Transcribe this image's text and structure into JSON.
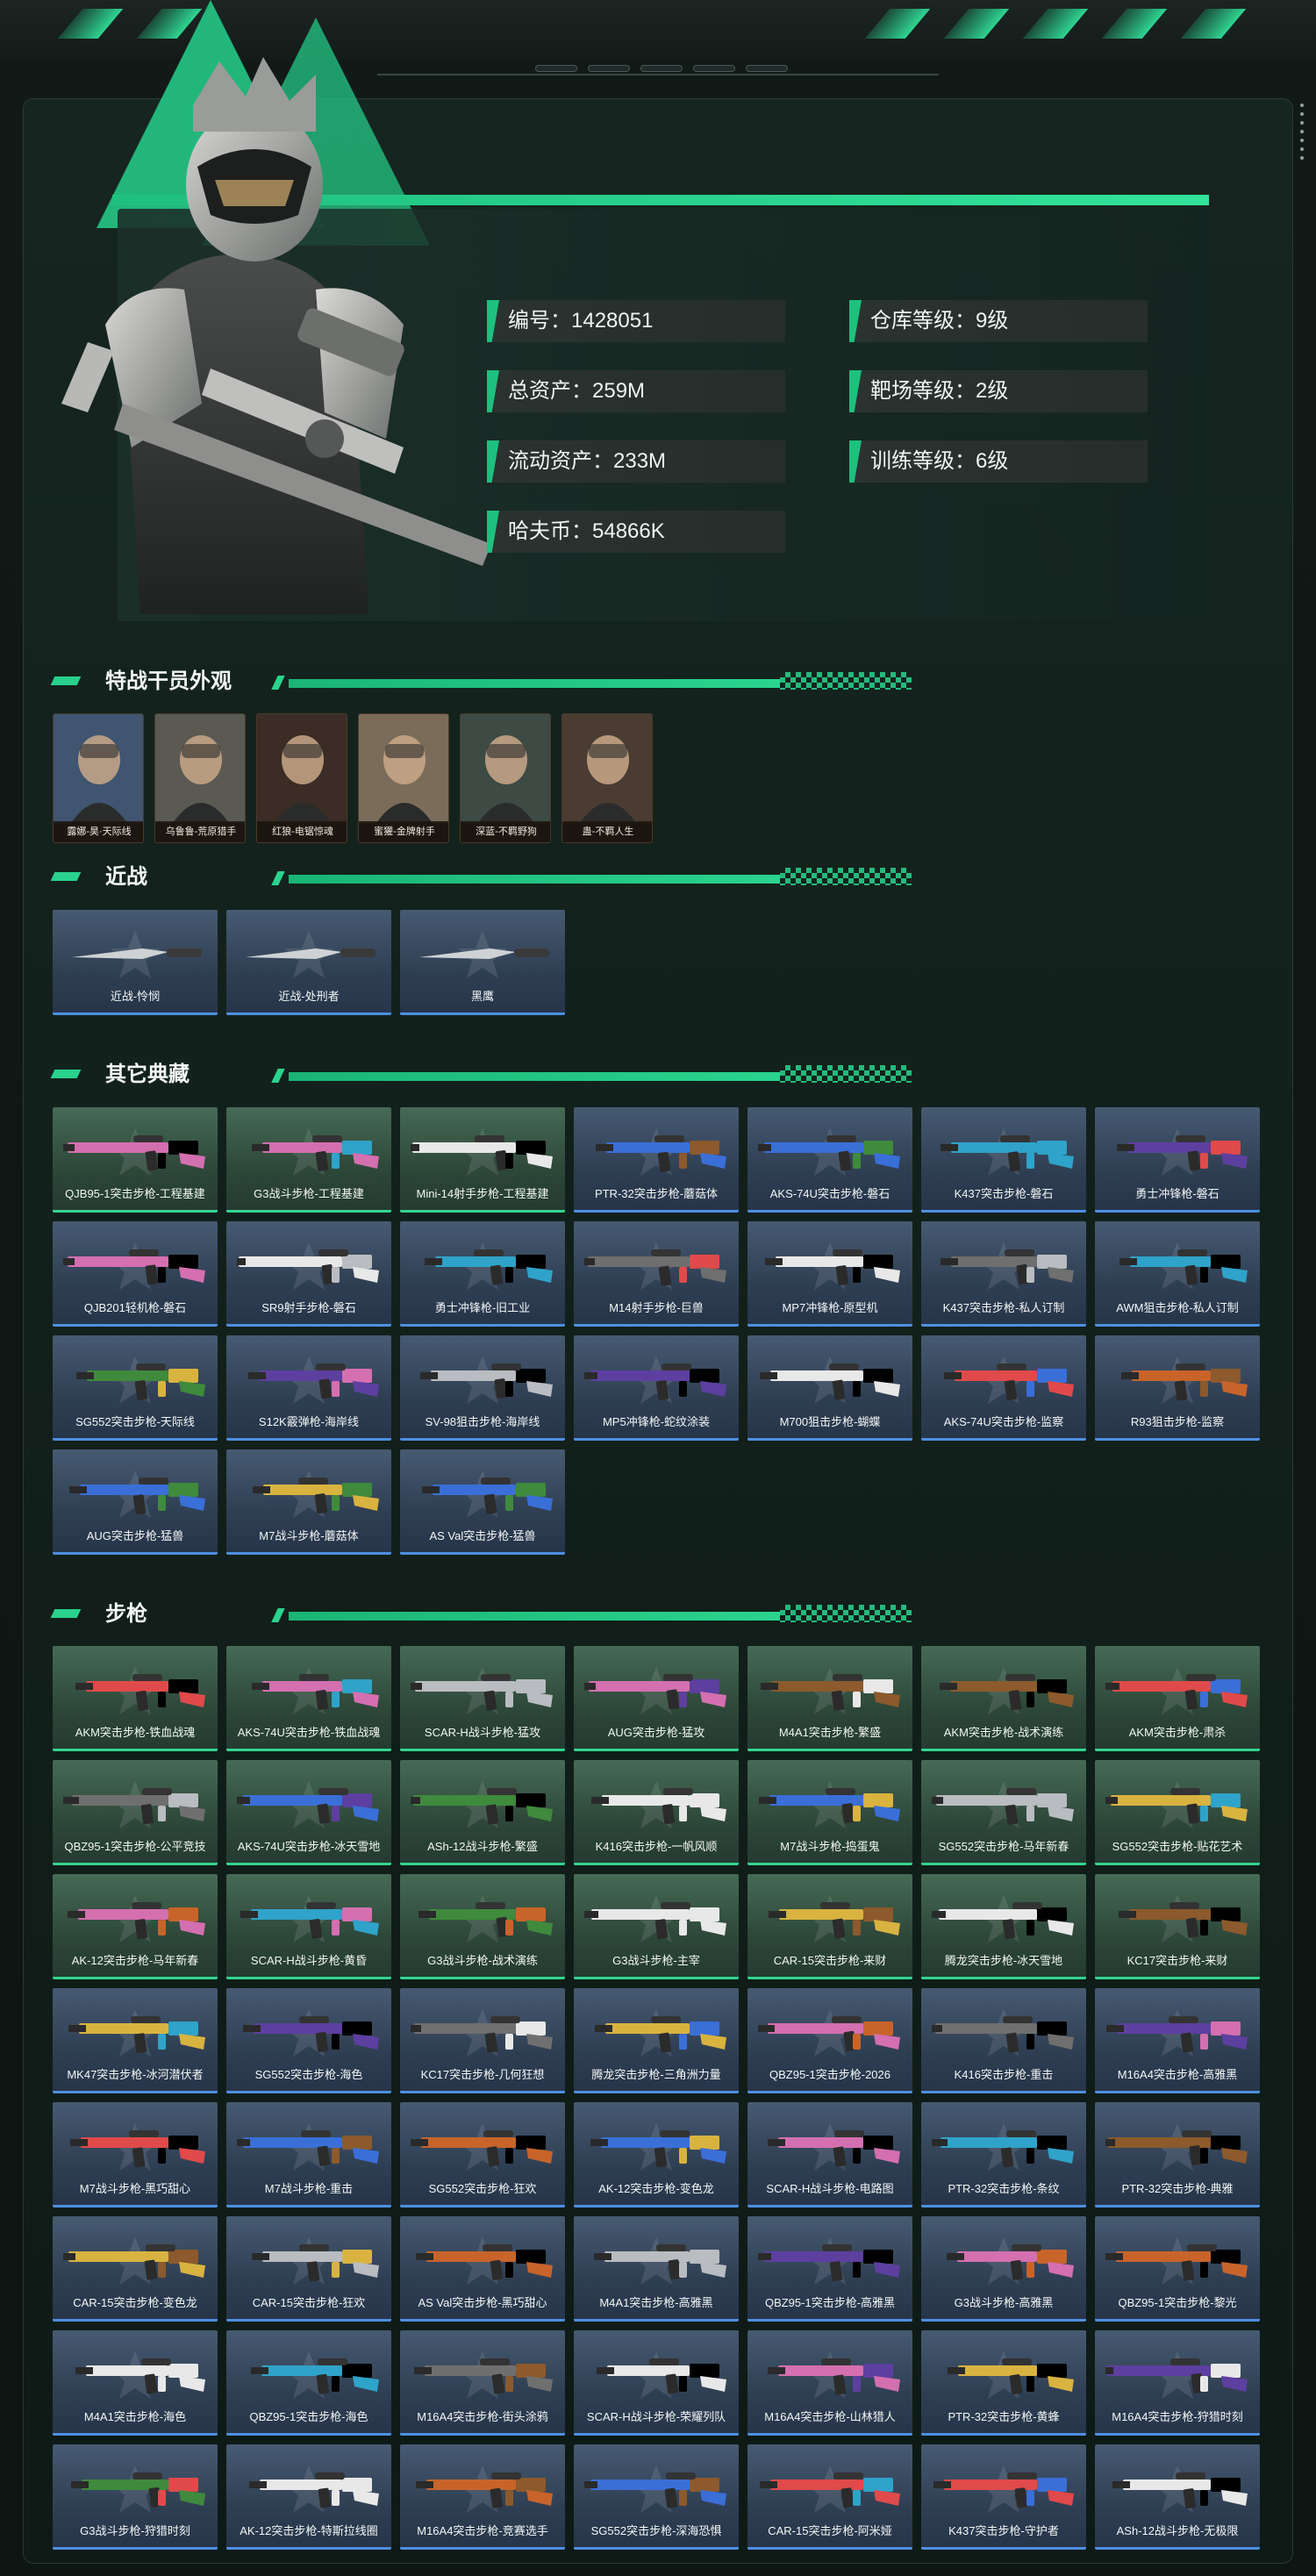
{
  "profile": {
    "stats_left": [
      {
        "label": "编号：1428051"
      },
      {
        "label": "总资产：259M"
      },
      {
        "label": "流动资产：233M"
      },
      {
        "label": "哈夫币：54866K"
      }
    ],
    "stats_right": [
      {
        "label": "仓库等级：9级"
      },
      {
        "label": "靶场等级：2级"
      },
      {
        "label": "训练等级：6级"
      }
    ]
  },
  "sections": {
    "agents": {
      "title": "特战干员外观",
      "items": [
        "露娜-昊·天际线",
        "乌鲁鲁-荒原猎手",
        "红狼-电锯惊魂",
        "蜜獾-金牌射手",
        "深蓝-不羁野狗",
        "蛊-不羁人生"
      ]
    },
    "melee": {
      "title": "近战",
      "items": [
        "近战-怜悯",
        "近战-处刑者",
        "黑鹰"
      ]
    },
    "others": {
      "title": "其它典藏",
      "items": [
        {
          "name": "QJB95-1突击步枪-工程基建",
          "tier": "g"
        },
        {
          "name": "G3战斗步枪-工程基建",
          "tier": "g"
        },
        {
          "name": "Mini-14射手步枪-工程基建",
          "tier": "g"
        },
        {
          "name": "PTR-32突击步枪-蘑菇体",
          "tier": "b"
        },
        {
          "name": "AKS-74U突击步枪-磐石",
          "tier": "b"
        },
        {
          "name": "K437突击步枪-磐石",
          "tier": "b"
        },
        {
          "name": "勇士冲锋枪-磐石",
          "tier": "b"
        },
        {
          "name": "QJB201轻机枪-磐石",
          "tier": "b"
        },
        {
          "name": "SR9射手步枪-磐石",
          "tier": "b"
        },
        {
          "name": "勇士冲锋枪-旧工业",
          "tier": "b"
        },
        {
          "name": "M14射手步枪-巨兽",
          "tier": "b"
        },
        {
          "name": "MP7冲锋枪-原型机",
          "tier": "b"
        },
        {
          "name": "K437突击步枪-私人订制",
          "tier": "b"
        },
        {
          "name": "AWM狙击步枪-私人订制",
          "tier": "b"
        },
        {
          "name": "SG552突击步枪-天际线",
          "tier": "b"
        },
        {
          "name": "S12K霰弹枪-海岸线",
          "tier": "b"
        },
        {
          "name": "SV-98狙击步枪-海岸线",
          "tier": "b"
        },
        {
          "name": "MP5冲锋枪-蛇纹涂装",
          "tier": "b"
        },
        {
          "name": "M700狙击步枪-蝴蝶",
          "tier": "b"
        },
        {
          "name": "AKS-74U突击步枪-监察",
          "tier": "b"
        },
        {
          "name": "R93狙击步枪-监察",
          "tier": "b"
        },
        {
          "name": "AUG突击步枪-猛兽",
          "tier": "b"
        },
        {
          "name": "M7战斗步枪-蘑菇体",
          "tier": "b"
        },
        {
          "name": "AS Val突击步枪-猛兽",
          "tier": "b"
        }
      ]
    },
    "rifles": {
      "title": "步枪",
      "items": [
        {
          "name": "AKM突击步枪-铁血战魂",
          "tier": "g"
        },
        {
          "name": "AKS-74U突击步枪-铁血战魂",
          "tier": "g"
        },
        {
          "name": "SCAR-H战斗步枪-猛攻",
          "tier": "g"
        },
        {
          "name": "AUG突击步枪-猛攻",
          "tier": "g"
        },
        {
          "name": "M4A1突击步枪-繁盛",
          "tier": "g"
        },
        {
          "name": "AKM突击步枪-战术演练",
          "tier": "g"
        },
        {
          "name": "AKM突击步枪-肃杀",
          "tier": "g"
        },
        {
          "name": "QBZ95-1突击步枪-公平竞技",
          "tier": "g"
        },
        {
          "name": "AKS-74U突击步枪-冰天雪地",
          "tier": "g"
        },
        {
          "name": "ASh-12战斗步枪-繁盛",
          "tier": "g"
        },
        {
          "name": "K416突击步枪-一帆风顺",
          "tier": "g"
        },
        {
          "name": "M7战斗步枪-捣蛋鬼",
          "tier": "g"
        },
        {
          "name": "SG552突击步枪-马年新春",
          "tier": "g"
        },
        {
          "name": "SG552突击步枪-贴花艺术",
          "tier": "g"
        },
        {
          "name": "AK-12突击步枪-马年新春",
          "tier": "g"
        },
        {
          "name": "SCAR-H战斗步枪-黄昏",
          "tier": "g"
        },
        {
          "name": "G3战斗步枪-战术演练",
          "tier": "g"
        },
        {
          "name": "G3战斗步枪-主宰",
          "tier": "g"
        },
        {
          "name": "CAR-15突击步枪-来财",
          "tier": "g"
        },
        {
          "name": "腾龙突击步枪-冰天雪地",
          "tier": "g"
        },
        {
          "name": "KC17突击步枪-来财",
          "tier": "g"
        },
        {
          "name": "MK47突击步枪-冰河潜伏者",
          "tier": "b"
        },
        {
          "name": "SG552突击步枪-海色",
          "tier": "b"
        },
        {
          "name": "KC17突击步枪-几何狂想",
          "tier": "b"
        },
        {
          "name": "腾龙突击步枪-三角洲力量",
          "tier": "b"
        },
        {
          "name": "QBZ95-1突击步枪-2026",
          "tier": "b"
        },
        {
          "name": "K416突击步枪-重击",
          "tier": "b"
        },
        {
          "name": "M16A4突击步枪-高雅黑",
          "tier": "b"
        },
        {
          "name": "M7战斗步枪-黑巧甜心",
          "tier": "b"
        },
        {
          "name": "M7战斗步枪-重击",
          "tier": "b"
        },
        {
          "name": "SG552突击步枪-狂欢",
          "tier": "b"
        },
        {
          "name": "AK-12突击步枪-变色龙",
          "tier": "b"
        },
        {
          "name": "SCAR-H战斗步枪-电路图",
          "tier": "b"
        },
        {
          "name": "PTR-32突击步枪-条纹",
          "tier": "b"
        },
        {
          "name": "PTR-32突击步枪-典雅",
          "tier": "b"
        },
        {
          "name": "CAR-15突击步枪-变色龙",
          "tier": "b"
        },
        {
          "name": "CAR-15突击步枪-狂欢",
          "tier": "b"
        },
        {
          "name": "AS Val突击步枪-黑巧甜心",
          "tier": "b"
        },
        {
          "name": "M4A1突击步枪-高雅黑",
          "tier": "b"
        },
        {
          "name": "QBZ95-1突击步枪-高雅黑",
          "tier": "b"
        },
        {
          "name": "G3战斗步枪-高雅黑",
          "tier": "b"
        },
        {
          "name": "QBZ95-1突击步枪-黎光",
          "tier": "b"
        },
        {
          "name": "M4A1突击步枪-海色",
          "tier": "b"
        },
        {
          "name": "QBZ95-1突击步枪-海色",
          "tier": "b"
        },
        {
          "name": "M16A4突击步枪-街头涂鸦",
          "tier": "b"
        },
        {
          "name": "SCAR-H战斗步枪-荣耀列队",
          "tier": "b"
        },
        {
          "name": "M16A4突击步枪-山林猎人",
          "tier": "b"
        },
        {
          "name": "PTR-32突击步枪-黄蜂",
          "tier": "b"
        },
        {
          "name": "M16A4突击步枪-狩猎时刻",
          "tier": "b"
        },
        {
          "name": "G3战斗步枪-狩猎时刻",
          "tier": "b"
        },
        {
          "name": "AK-12突击步枪-特斯拉线圈",
          "tier": "b"
        },
        {
          "name": "M16A4突击步枪-竞赛选手",
          "tier": "b"
        },
        {
          "name": "SG552突击步枪-深海恐惧",
          "tier": "b"
        },
        {
          "name": "CAR-15突击步枪-阿米娅",
          "tier": "b"
        },
        {
          "name": "K437突击步枪-守护者",
          "tier": "b"
        },
        {
          "name": "ASh-12战斗步枪-无极限",
          "tier": "b"
        }
      ]
    }
  },
  "colors": {
    "accent": "#29d18c",
    "gold_tier_edge": "#32d58f",
    "blue_tier_edge": "#4e8fe0"
  }
}
